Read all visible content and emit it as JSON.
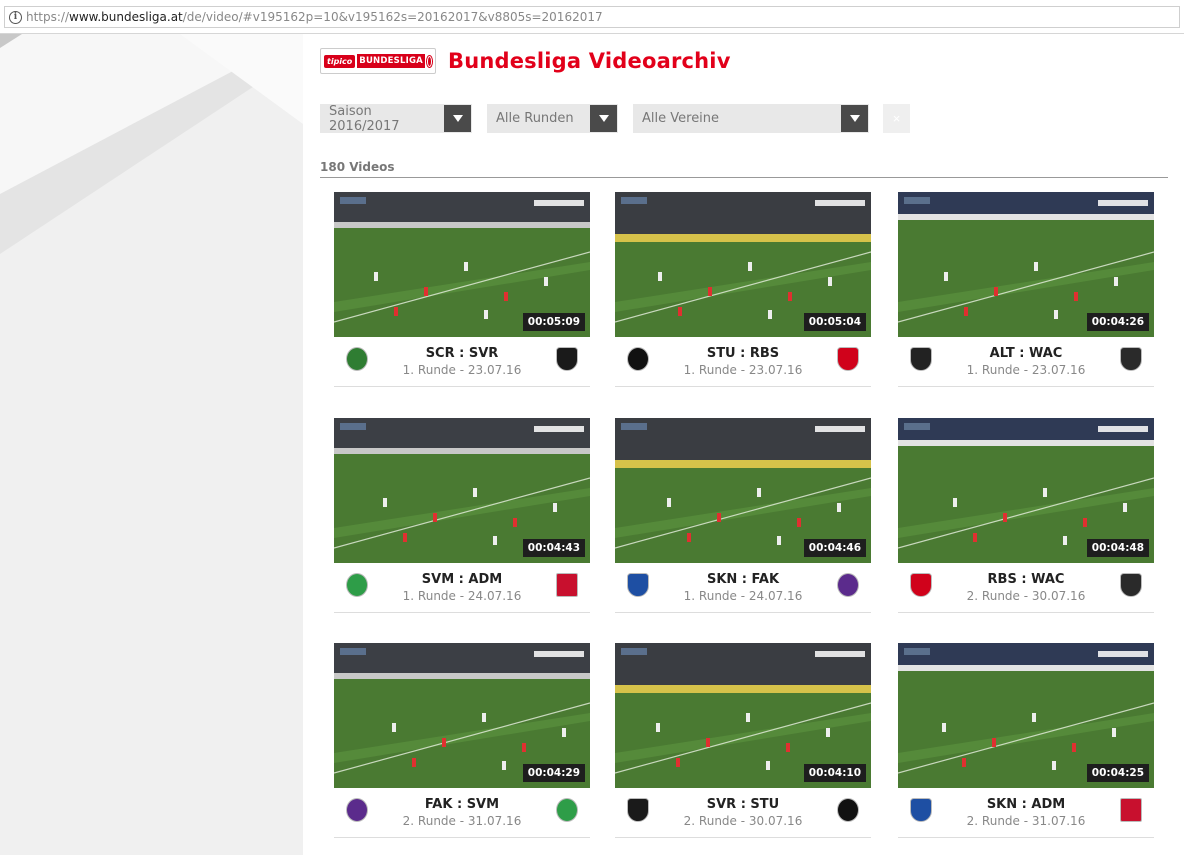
{
  "browser": {
    "url_prefix": "https://",
    "url_host": "www.bundesliga.at",
    "url_path": "/de/video/#v195162p=10&v195162s=20162017&v8805s=20162017"
  },
  "header": {
    "logo_tipico": "tipico",
    "logo_text": "BUNDESLIGA",
    "title": "Bundesliga Videoarchiv"
  },
  "filters": {
    "saison": "Saison 2016/2017",
    "runden": "Alle Runden",
    "vereine": "Alle Vereine",
    "clear": "×"
  },
  "video_count": "180 Videos",
  "videos": [
    {
      "match": "SCR : SVR",
      "round": "1. Runde - 23.07.16",
      "duration": "00:05:09",
      "home_crest": "rapid-crest",
      "away_crest": "ried-crest"
    },
    {
      "match": "STU : RBS",
      "round": "1. Runde - 23.07.16",
      "duration": "00:05:04",
      "home_crest": "sturm-crest",
      "away_crest": "salzburg-crest"
    },
    {
      "match": "ALT : WAC",
      "round": "1. Runde - 23.07.16",
      "duration": "00:04:26",
      "home_crest": "altach-crest",
      "away_crest": "wac-crest"
    },
    {
      "match": "SVM : ADM",
      "round": "1. Runde - 24.07.16",
      "duration": "00:04:43",
      "home_crest": "mattersburg-crest",
      "away_crest": "admira-crest"
    },
    {
      "match": "SKN : FAK",
      "round": "1. Runde - 24.07.16",
      "duration": "00:04:46",
      "home_crest": "st-poelten-crest",
      "away_crest": "austria-crest"
    },
    {
      "match": "RBS : WAC",
      "round": "2. Runde - 30.07.16",
      "duration": "00:04:48",
      "home_crest": "salzburg-crest",
      "away_crest": "wac-crest"
    },
    {
      "match": "FAK : SVM",
      "round": "2. Runde - 31.07.16",
      "duration": "00:04:29",
      "home_crest": "austria-crest",
      "away_crest": "mattersburg-crest"
    },
    {
      "match": "SVR : STU",
      "round": "2. Runde - 30.07.16",
      "duration": "00:04:10",
      "home_crest": "ried-crest",
      "away_crest": "sturm-crest"
    },
    {
      "match": "SKN : ADM",
      "round": "2. Runde - 31.07.16",
      "duration": "00:04:25",
      "home_crest": "st-poelten-crest",
      "away_crest": "admira-crest"
    }
  ],
  "colors": {
    "brand_red": "#e2001a",
    "pitch_green": "#4a7a32",
    "dropdown_arrow_bg": "#4a4a4a"
  }
}
